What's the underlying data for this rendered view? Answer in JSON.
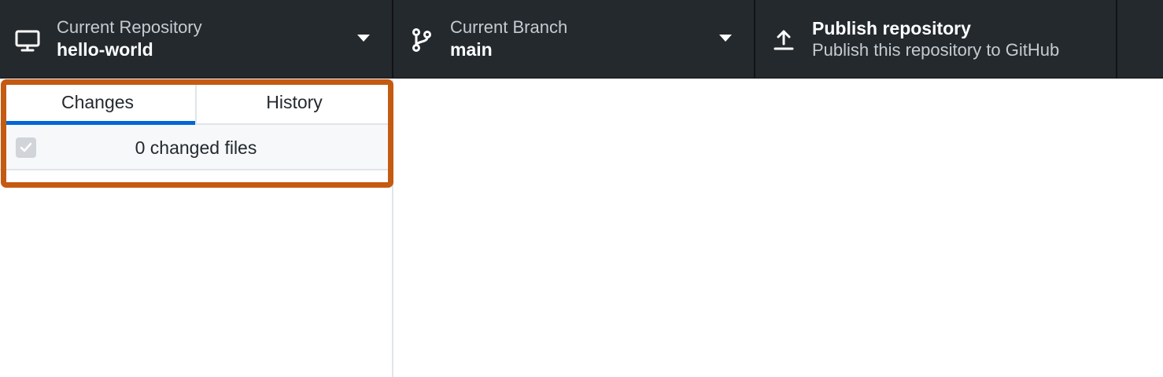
{
  "toolbar": {
    "repository": {
      "label": "Current Repository",
      "value": "hello-world",
      "icon": "desktop-icon"
    },
    "branch": {
      "label": "Current Branch",
      "value": "main",
      "icon": "git-branch-icon"
    },
    "publish": {
      "title": "Publish repository",
      "subtitle": "Publish this repository to GitHub",
      "icon": "upload-icon"
    }
  },
  "sidebar": {
    "tabs": [
      {
        "label": "Changes",
        "selected": true
      },
      {
        "label": "History",
        "selected": false
      }
    ],
    "changes_summary": "0 changed files"
  },
  "colors": {
    "toolbar_bg": "#24292e",
    "accent": "#0366d6",
    "highlight": "#c55a11"
  }
}
